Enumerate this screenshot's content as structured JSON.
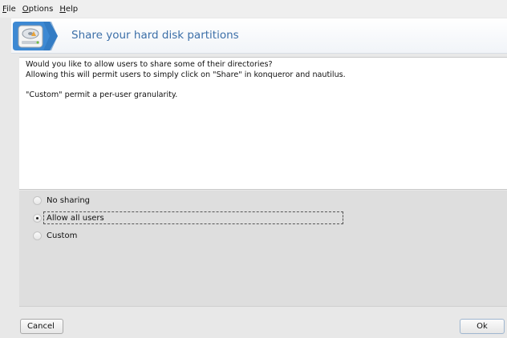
{
  "menu": {
    "file": {
      "mnemonic": "F",
      "rest": "ile"
    },
    "options": {
      "mnemonic": "O",
      "rest": "ptions"
    },
    "help": {
      "mnemonic": "H",
      "rest": "elp"
    }
  },
  "header": {
    "icon": "hard-disk-share-icon",
    "title": "Share your hard disk partitions"
  },
  "description": {
    "line1": "Would you like to allow users to share some of their directories?",
    "line2": "Allowing this will permit users to simply click on \"Share\" in konqueror and nautilus.",
    "line3": "\"Custom\" permit a per-user granularity."
  },
  "options": {
    "selected": "Allow all users",
    "items": [
      {
        "label": "No sharing",
        "checked": false
      },
      {
        "label": "Allow all users",
        "checked": true
      },
      {
        "label": "Custom",
        "checked": false
      }
    ]
  },
  "buttons": {
    "cancel": "Cancel",
    "ok": "Ok"
  },
  "colors": {
    "title": "#3c6fa8",
    "accent_tab": "#3d89d3"
  }
}
